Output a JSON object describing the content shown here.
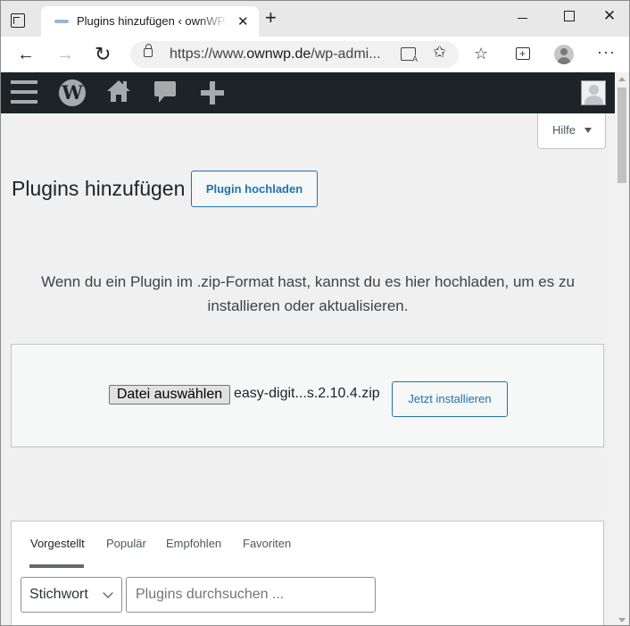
{
  "browser": {
    "tab_title": "Plugins hinzufügen ‹ ownWP.de — WordPress",
    "tab_close": "✕",
    "new_tab": "+",
    "window_close": "✕",
    "nav_back": "←",
    "nav_forward": "→",
    "nav_reload": "↻",
    "url_prefix": "https://www.",
    "url_domain": "ownwp.de",
    "url_path": "/wp-admi...",
    "favorites_icon": "☆",
    "add_favorite_icon": "✩",
    "more_icon": "···"
  },
  "adminbar": {
    "wp_logo": "W"
  },
  "page": {
    "help_label": "Hilfe",
    "title": "Plugins hinzufügen",
    "upload_button": "Plugin hochladen",
    "upload_help": "Wenn du ein Plugin im .zip-Format hast, kannst du es hier hochladen, um es zu installieren oder aktualisieren.",
    "choose_file_label": "Datei auswählen",
    "file_name": "easy-digit...s.2.10.4.zip",
    "install_button": "Jetzt installieren"
  },
  "filter": {
    "tabs": [
      {
        "label": "Vorgestellt"
      },
      {
        "label": "Populär"
      },
      {
        "label": "Empfohlen"
      },
      {
        "label": "Favoriten"
      }
    ],
    "search_type": "Stichwort",
    "search_placeholder": "Plugins durchsuchen ..."
  },
  "colors": {
    "accent": "#2271b1",
    "adminbar": "#1d2327",
    "admin_icons": "#a7aaad"
  }
}
